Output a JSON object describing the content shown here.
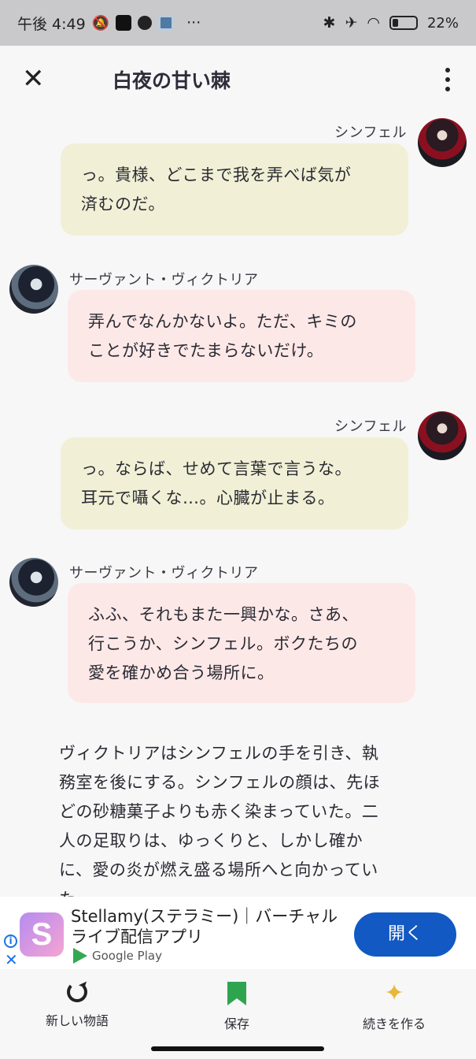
{
  "status_bar": {
    "time": "午後 4:49",
    "battery": "22%",
    "more": "···"
  },
  "header": {
    "title": "白夜の甘い棘"
  },
  "messages": [
    {
      "speaker": "シンフェル",
      "text_lines": [
        "っ。貴様、どこまで我を弄べば気が",
        "済むのだ。"
      ]
    },
    {
      "speaker": "サーヴァント・ヴィクトリア",
      "text_lines": [
        "弄んでなんかないよ。ただ、キミの",
        "ことが好きでたまらないだけ。"
      ]
    },
    {
      "speaker": "シンフェル",
      "text_lines": [
        "っ。ならば、せめて言葉で言うな。",
        "耳元で囁くな…。心臓が止まる。"
      ]
    },
    {
      "speaker": "サーヴァント・ヴィクトリア",
      "text_lines": [
        "ふふ、それもまた一興かな。さあ、",
        "行こうか、シンフェル。ボクたちの",
        "愛を確かめ合う場所に。"
      ]
    }
  ],
  "narration_lines": [
    "ヴィクトリアはシンフェルの手を引き、執",
    "務室を後にする。シンフェルの顔は、先ほ",
    "どの砂糖菓子よりも赤く染まっていた。二",
    "人の足取りは、ゆっくりと、しかし確か",
    "に、愛の炎が燃え盛る場所へと向かってい",
    "た。"
  ],
  "ad": {
    "logo_letter": "S",
    "title_line1": "Stellamy(ステラミー)｜バーチャル",
    "title_line2": "ライブ配信アプリ",
    "store": "Google Play",
    "open_label": "開く",
    "info": "i",
    "close": "✕"
  },
  "bottom_nav": {
    "new_story": "新しい物語",
    "save": "保存",
    "continue": "続きを作る"
  },
  "colors": {
    "bubble_self": "#f1f0d6",
    "bubble_other": "#fde8e8",
    "ad_button": "#1259c3",
    "save_icon": "#2ea44f",
    "sparkle_icon": "#e7b839"
  }
}
